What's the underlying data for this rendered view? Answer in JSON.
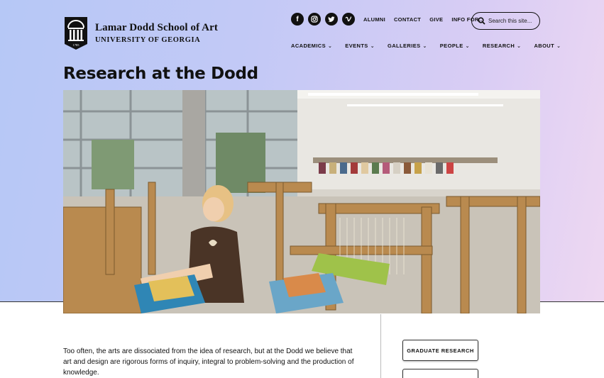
{
  "logo": {
    "line1": "Lamar Dodd School of Art",
    "line2": "UNIVERSITY OF GEORGIA",
    "year": "1785"
  },
  "social": [
    {
      "icon": "facebook-icon",
      "glyph": "f"
    },
    {
      "icon": "instagram-icon",
      "glyph": ""
    },
    {
      "icon": "twitter-icon",
      "glyph": ""
    },
    {
      "icon": "vimeo-icon",
      "glyph": ""
    }
  ],
  "utility_links": [
    "ALUMNI",
    "CONTACT",
    "GIVE",
    "INFO FOR..."
  ],
  "search": {
    "placeholder": "Search this site..."
  },
  "nav": [
    {
      "label": "ACADEMICS"
    },
    {
      "label": "EVENTS"
    },
    {
      "label": "GALLERIES"
    },
    {
      "label": "PEOPLE"
    },
    {
      "label": "RESEARCH"
    },
    {
      "label": "ABOUT"
    }
  ],
  "page": {
    "title": "Research at the Dodd"
  },
  "hero": {
    "description": "weaving studio with looms"
  },
  "intro": {
    "text": "Too often, the arts are dissociated from the idea of research, but at the Dodd we believe that art and design are rigorous forms of inquiry, integral to problem-solving and the production of knowledge."
  },
  "sidebar": {
    "buttons": [
      {
        "label": "GRADUATE RESEARCH"
      },
      {
        "label": ""
      }
    ]
  },
  "colors": {
    "hero_gradient_start": "#b6c8f6",
    "hero_gradient_end": "#eed8f2"
  }
}
